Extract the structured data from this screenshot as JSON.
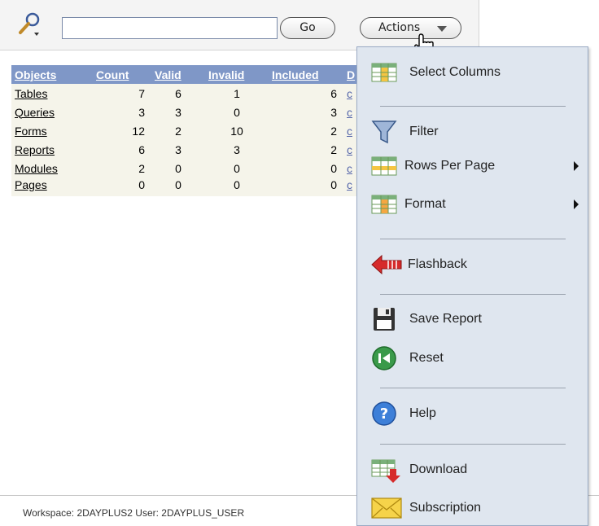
{
  "search": {
    "value": "",
    "go_label": "Go",
    "actions_label": "Actions",
    "icon": "search-icon"
  },
  "report": {
    "columns": [
      "Objects",
      "Count",
      "Valid",
      "Invalid",
      "Included",
      "D"
    ],
    "rows": [
      {
        "object": "Tables",
        "count": "7",
        "valid": "6",
        "invalid": "1",
        "included": "6",
        "link": "c"
      },
      {
        "object": "Queries",
        "count": "3",
        "valid": "3",
        "invalid": "0",
        "included": "3",
        "link": "c"
      },
      {
        "object": "Forms",
        "count": "12",
        "valid": "2",
        "invalid": "10",
        "included": "2",
        "link": "c"
      },
      {
        "object": "Reports",
        "count": "6",
        "valid": "3",
        "invalid": "3",
        "included": "2",
        "link": "c"
      },
      {
        "object": "Modules",
        "count": "2",
        "valid": "0",
        "invalid": "0",
        "included": "0",
        "link": "c"
      },
      {
        "object": "Pages",
        "count": "0",
        "valid": "0",
        "invalid": "0",
        "included": "0",
        "link": "c"
      }
    ]
  },
  "footer": {
    "text": "Workspace: 2DAYPLUS2 User: 2DAYPLUS_USER"
  },
  "menu": {
    "items": [
      {
        "label": "Select Columns",
        "icon": "table-columns-icon"
      },
      {
        "label": "Filter",
        "icon": "funnel-icon"
      },
      {
        "label": "Rows Per Page",
        "icon": "table-rows-icon"
      },
      {
        "label": "Format",
        "icon": "table-format-icon"
      },
      {
        "label": "Flashback",
        "icon": "back-arrow-icon"
      },
      {
        "label": "Save Report",
        "icon": "floppy-disk-icon"
      },
      {
        "label": "Reset",
        "icon": "reset-icon"
      },
      {
        "label": "Help",
        "icon": "help-icon"
      },
      {
        "label": "Download",
        "icon": "download-icon"
      },
      {
        "label": "Subscription",
        "icon": "envelope-icon"
      }
    ]
  },
  "colors": {
    "header_bg": "#7f97c7",
    "row_bg": "#f5f4ea",
    "menu_bg": "#dfe6ef"
  }
}
